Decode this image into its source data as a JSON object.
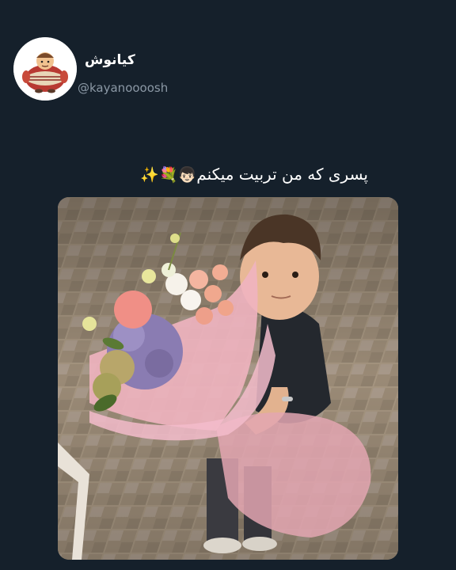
{
  "author": {
    "display_name": "کیانوش",
    "handle": "@kayanoooosh",
    "avatar_icon": "cartoon-character-avatar"
  },
  "tweet": {
    "text": "پسری که من تربیت میکنم",
    "emojis": "👦🏻💐✨"
  },
  "media": {
    "description_icon": "photo-child-with-flower-bouquet"
  },
  "colors": {
    "background": "#15202b",
    "secondary_text": "#8b98a5",
    "primary_text": "#ffffff"
  }
}
